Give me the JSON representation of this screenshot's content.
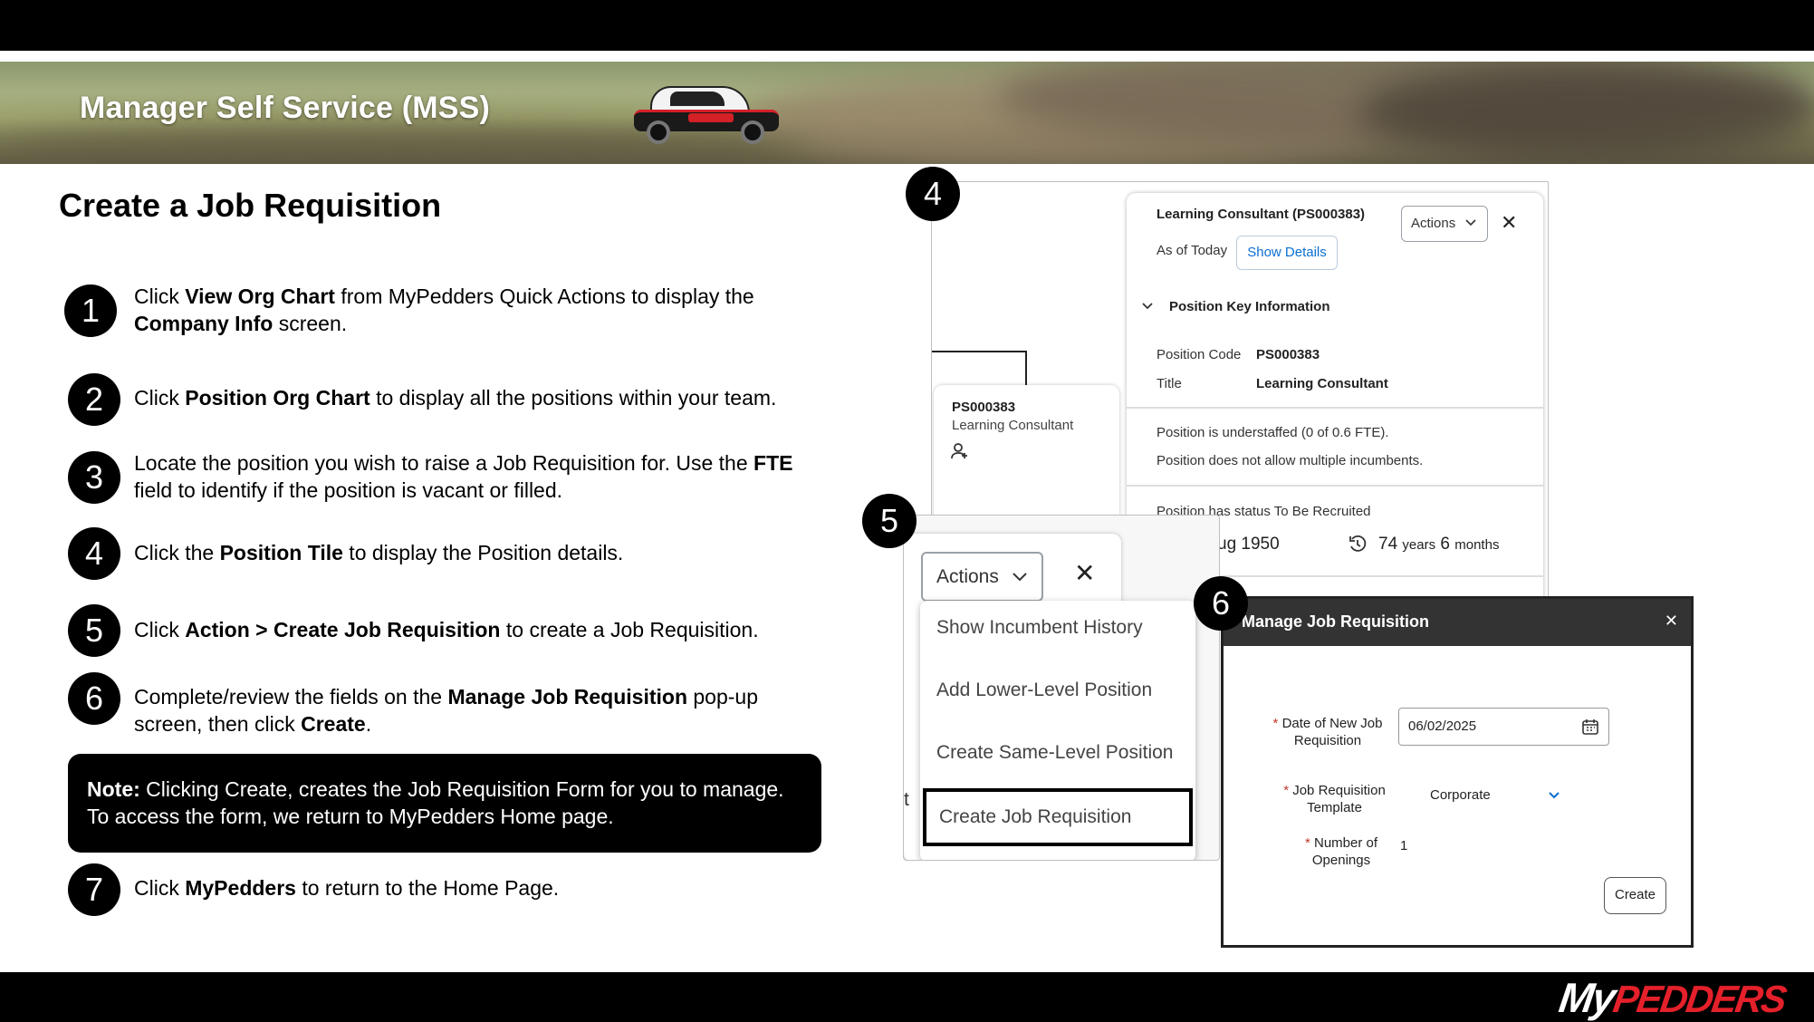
{
  "header": {
    "banner_title": "Manager Self Service (MSS)"
  },
  "page_title": "Create a Job Requisition",
  "steps": [
    {
      "num": "1",
      "parts": [
        "Click ",
        "View Org Chart",
        " from MyPedders Quick Actions to display the ",
        "Company Info",
        " screen."
      ]
    },
    {
      "num": "2",
      "parts": [
        "Click  ",
        "Position Org Chart",
        " to display all the positions within your team."
      ]
    },
    {
      "num": "3",
      "parts": [
        "Locate the position you wish to raise a Job Requisition for. Use the ",
        "FTE",
        " field to identify if the position is vacant or filled."
      ]
    },
    {
      "num": "4",
      "parts": [
        "Click the ",
        "Position Tile",
        " to display the Position details."
      ]
    },
    {
      "num": "5",
      "parts": [
        "Click ",
        "Action > Create Job Requisition",
        " to create a Job Requisition."
      ]
    },
    {
      "num": "6",
      "parts": [
        "Complete/review the fields on the ",
        "Manage Job Requisition",
        " pop-up screen, then click ",
        "Create",
        "."
      ]
    },
    {
      "num": "7",
      "parts": [
        "Click ",
        "MyPedders",
        " to return to the Home Page."
      ]
    }
  ],
  "note": {
    "label": "Note:",
    "text": " Clicking Create, creates the Job Requisition Form for you to manage. To access the form, we return to MyPedders Home page."
  },
  "shot4": {
    "badge": "4",
    "title": "Learning Consultant (PS000383)",
    "actions_label": "Actions",
    "as_of": "As of Today",
    "show_details": "Show Details",
    "section": "Position Key Information",
    "code_label": "Position Code",
    "code_value": "PS000383",
    "title_label": "Title",
    "title_value": "Learning Consultant",
    "msg1": "Position is understaffed (0 of 0.6 FTE).",
    "msg2": "Position does not allow multiple incumbents.",
    "msg3": "Position has status To Be Recruited",
    "date_partial": "ug 1950",
    "tenure_years": "74",
    "years_word": "years",
    "tenure_months": "6",
    "months_word": "months",
    "tile_code": "PS000383",
    "tile_title": "Learning Consultant"
  },
  "shot5": {
    "badge": "5",
    "actions_label": "Actions",
    "menu": [
      "Show Incumbent History",
      "Add Lower-Level Position",
      "Create Same-Level Position",
      "Create Job Requisition"
    ],
    "edge_char": "t"
  },
  "shot6": {
    "badge": "6",
    "title": "Manage Job Requisition",
    "date_label": "Date of New Job Requisition",
    "date_value": "06/02/2025",
    "template_label": "Job Requisition Template",
    "template_value": "Corporate",
    "openings_label": "Number of Openings",
    "openings_value": "1",
    "create_label": "Create"
  },
  "footer": {
    "logo_my": "My",
    "logo_rest": "PEDDERS"
  },
  "colors": {
    "accent_blue": "#0a6ed1",
    "logo_red": "#e4202a"
  }
}
